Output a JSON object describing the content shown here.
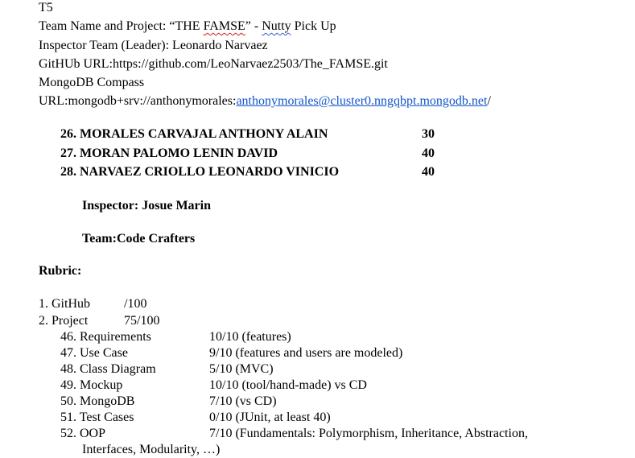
{
  "header": {
    "t5": "T5",
    "team_prefix": "Team Name and Project: “THE ",
    "team_famse": "FAMSE",
    "team_mid": "” - ",
    "team_nutty": "Nutty",
    "team_suffix": " Pick Up",
    "inspector_team": "Inspector Team (Leader): Leonardo Narvaez",
    "github": "GitHUb URL:https://github.com/LeoNarvaez2503/The_FAMSE.git",
    "mongo_label": "MongoDB Compass",
    "mongo_url_prefix": "URL:mongodb+srv://anthonymorales:",
    "mongo_url_link": "anthonymorales@cluster0.nngqbpt.mongodb.net",
    "mongo_url_suffix": "/"
  },
  "members": [
    {
      "label": "26. MORALES CARVAJAL ANTHONY ALAIN",
      "score": "30"
    },
    {
      "label": "27. MORAN PALOMO LENIN DAVID",
      "score": "40"
    },
    {
      "label": "28. NARVAEZ CRIOLLO LEONARDO VINICIO",
      "score": "40"
    }
  ],
  "inspector": "Inspector: Josue Marin",
  "team": "Team:Code Crafters",
  "rubric_title": "Rubric:",
  "rubric": {
    "github_label": "1. GitHub",
    "github_score": "/100",
    "project_label": "2. Project",
    "project_score": "75/100",
    "items": [
      {
        "label": "46. Requirements",
        "value": "10/10 (features)"
      },
      {
        "label": "47. Use Case",
        "value": "9/10 (features and users are modeled)"
      },
      {
        "label": "48. Class Diagram",
        "value": "5/10 (MVC)"
      },
      {
        "label": "49. Mockup",
        "value": "10/10 (tool/hand-made) vs CD"
      },
      {
        "label": "50. MongoDB",
        "value": "7/10 (vs CD)"
      },
      {
        "label": "51. Test Cases",
        "value": "0/10 (JUnit, at least 40)"
      },
      {
        "label": "52. OOP",
        "value": "7/10 (Fundamentals: Polymorphism, Inheritance, Abstraction,"
      }
    ],
    "oop_continuation": "Interfaces, Modularity, …)"
  }
}
